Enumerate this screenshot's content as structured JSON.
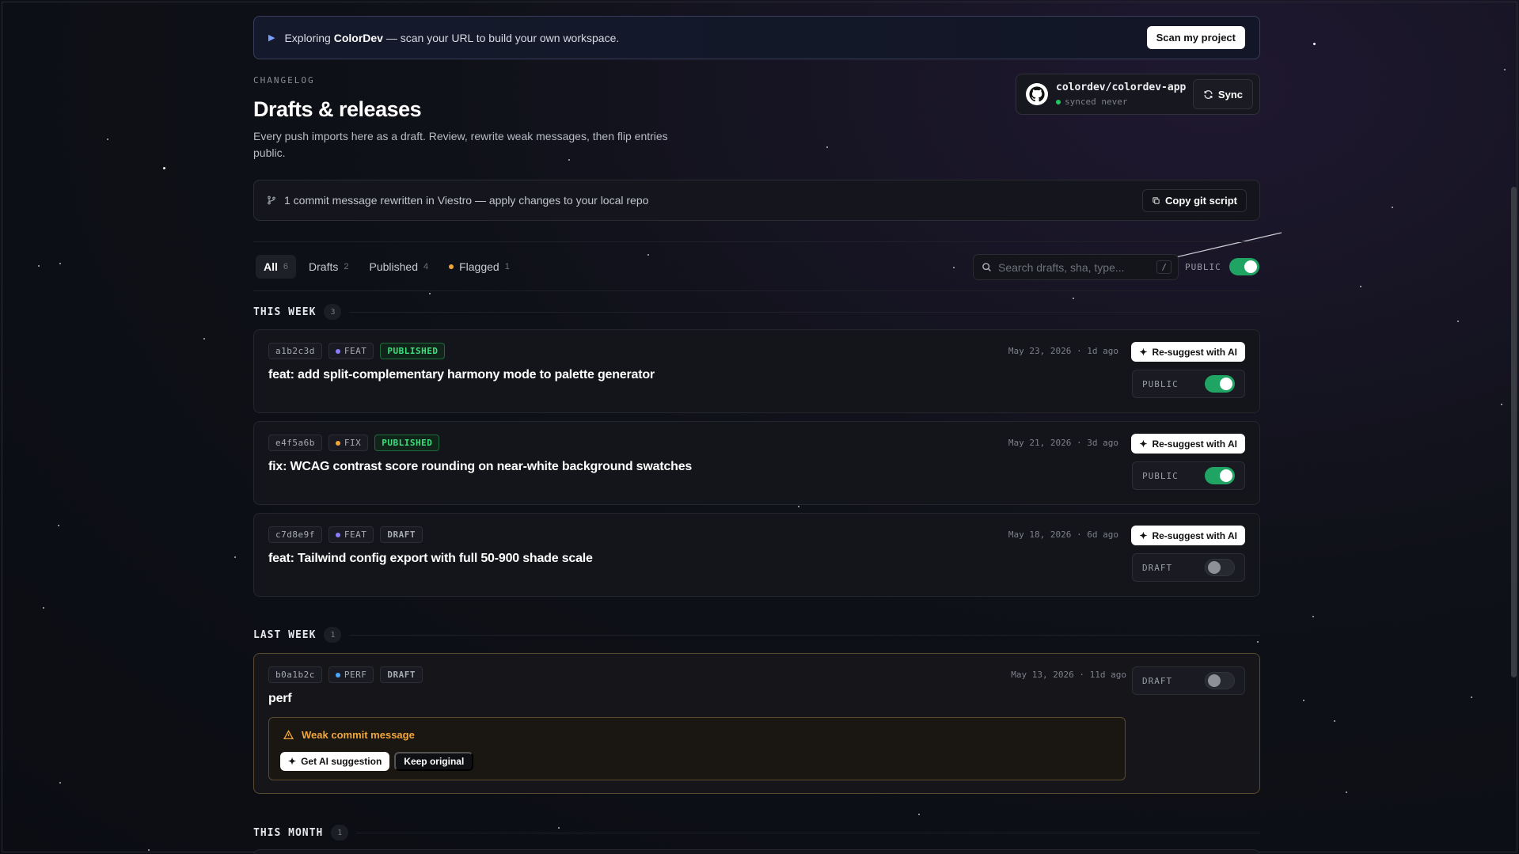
{
  "banner": {
    "prefix": "Exploring",
    "brand": "ColorDev",
    "suffix": "— scan your URL to build your own workspace.",
    "cta": "Scan my project"
  },
  "header": {
    "eyebrow": "CHANGELOG",
    "title": "Drafts & releases",
    "description": "Every push imports here as a draft. Review, rewrite weak messages, then flip entries public."
  },
  "repo": {
    "name": "colordev/colordev-app",
    "status": "synced never",
    "sync_label": "Sync"
  },
  "notice": {
    "text": "1 commit message rewritten in Viestro — apply changes to your local repo",
    "button": "Copy git script"
  },
  "tabs": [
    {
      "label": "All",
      "count": "6"
    },
    {
      "label": "Drafts",
      "count": "2"
    },
    {
      "label": "Published",
      "count": "4"
    },
    {
      "label": "Flagged",
      "count": "1"
    }
  ],
  "search": {
    "placeholder": "Search drafts, sha, type...",
    "shortcut": "/"
  },
  "global_toggle": {
    "label": "PUBLIC",
    "on": true
  },
  "sections": [
    {
      "title": "THIS WEEK",
      "count": "3"
    },
    {
      "title": "LAST WEEK",
      "count": "1"
    },
    {
      "title": "THIS MONTH",
      "count": "1"
    }
  ],
  "entries": [
    {
      "sha": "a1b2c3d",
      "type": "FEAT",
      "type_color": "#8b7bff",
      "status": "PUBLISHED",
      "title": "feat: add split-complementary harmony mode to palette generator",
      "date": "May 23, 2026 · 1d ago",
      "resuggest": "Re-suggest with AI",
      "visibility": "PUBLIC",
      "on": true
    },
    {
      "sha": "e4f5a6b",
      "type": "FIX",
      "type_color": "#f0a63a",
      "status": "PUBLISHED",
      "title": "fix: WCAG contrast score rounding on near-white background swatches",
      "date": "May 21, 2026 · 3d ago",
      "resuggest": "Re-suggest with AI",
      "visibility": "PUBLIC",
      "on": true
    },
    {
      "sha": "c7d8e9f",
      "type": "FEAT",
      "type_color": "#8b7bff",
      "status": "DRAFT",
      "title": "feat: Tailwind config export with full 50-900 shade scale",
      "date": "May 18, 2026 · 6d ago",
      "resuggest": "Re-suggest with AI",
      "visibility": "DRAFT",
      "on": false
    },
    {
      "sha": "b0a1b2c",
      "type": "PERF",
      "type_color": "#4aa8ff",
      "status": "DRAFT",
      "title": "perf",
      "date": "May 13, 2026 · 11d ago",
      "visibility": "DRAFT",
      "on": false,
      "warning": {
        "title": "Weak commit message",
        "primary": "Get AI suggestion",
        "secondary": "Keep original"
      }
    }
  ]
}
